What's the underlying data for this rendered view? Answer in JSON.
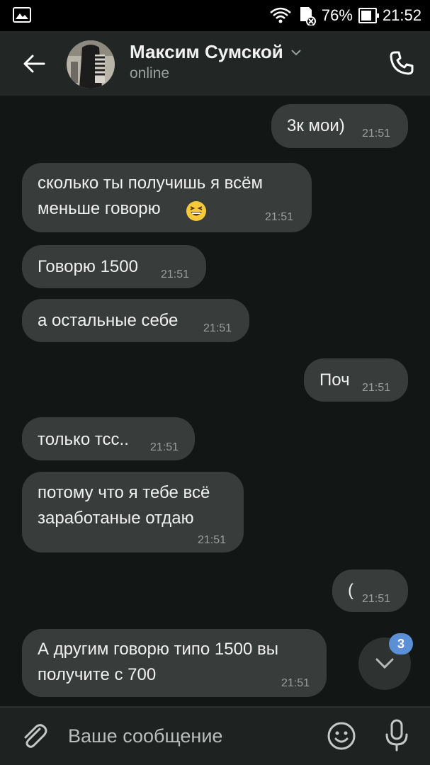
{
  "status_bar": {
    "battery": "76%",
    "battery_level": 0.76,
    "time": "21:52"
  },
  "header": {
    "contact_name": "Максим Сумской",
    "status": "online"
  },
  "messages": [
    {
      "side": "out",
      "lines": "3к мои)",
      "time": "21:51"
    },
    {
      "side": "in",
      "lines": "сколько ты получишь я всём\nменьше говорю",
      "emoji": "grinning-squinting-face",
      "time": "21:51"
    },
    {
      "side": "in",
      "lines": "Говорю 1500",
      "time": "21:51"
    },
    {
      "side": "in",
      "lines": "а остальные себе",
      "time": "21:51"
    },
    {
      "side": "out",
      "lines": "Поч",
      "time": "21:51"
    },
    {
      "side": "in",
      "lines": "только тсс..",
      "time": "21:51"
    },
    {
      "side": "in",
      "lines": "потому что я тебе всё\nзаработаные отдаю",
      "time": "21:51"
    },
    {
      "side": "out",
      "lines": "(",
      "time": "21:51"
    },
    {
      "side": "in",
      "lines": "А другим говорю типо 1500 вы\nполучите с 700",
      "time": "21:51"
    }
  ],
  "scroll_down": {
    "unread_count": "3"
  },
  "composer": {
    "placeholder": "Ваше сообщение"
  }
}
